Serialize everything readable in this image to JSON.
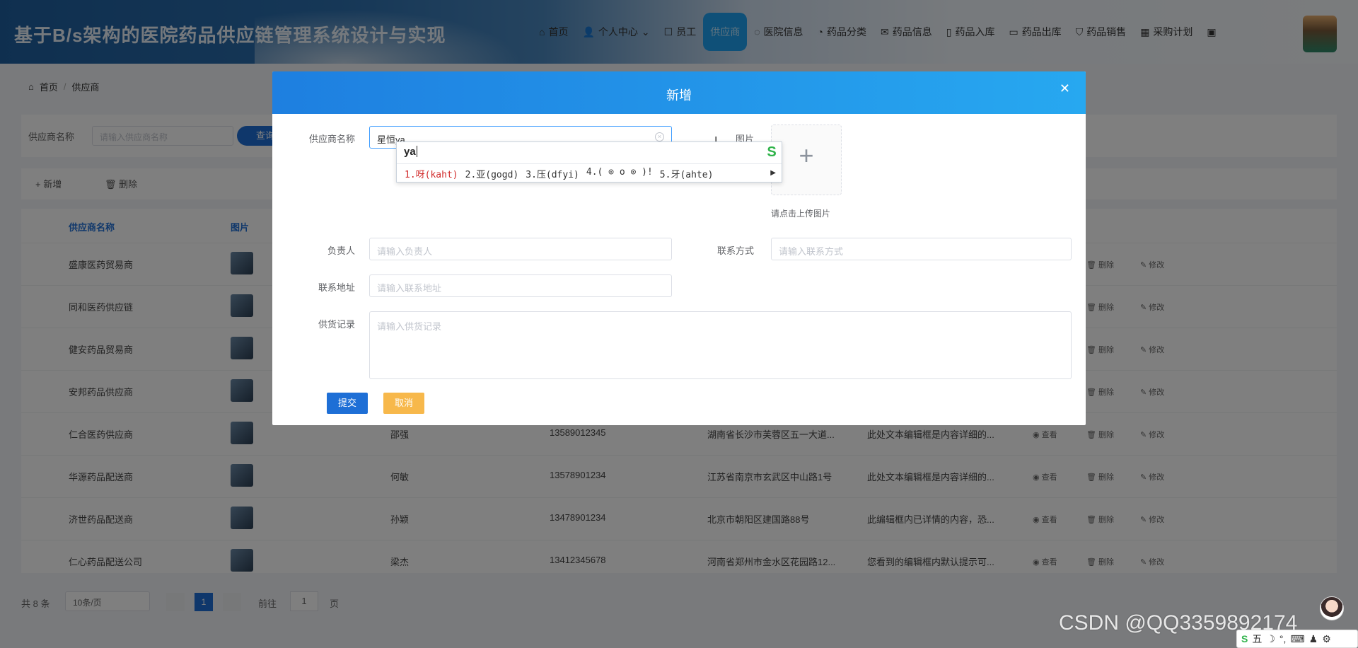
{
  "header": {
    "system_title": "基于B/s架构的医院药品供应链管理系统设计与实现",
    "nav": [
      {
        "icon": "home-icon",
        "glyph": "⌂",
        "label": "首页",
        "active": false
      },
      {
        "icon": "user-icon",
        "glyph": "👤",
        "label": "个人中心",
        "active": false,
        "dropdown": "⌄"
      },
      {
        "icon": "staff-icon",
        "glyph": "☐",
        "label": "员工",
        "active": false
      },
      {
        "icon": "supplier-icon",
        "glyph": "",
        "label": "供应商",
        "active": true
      },
      {
        "icon": "chat-icon",
        "glyph": "◌",
        "label": "医院信息",
        "active": false
      },
      {
        "icon": "clock-icon",
        "glyph": "◔",
        "label": "药品分类",
        "active": false
      },
      {
        "icon": "mail-icon",
        "glyph": "✉",
        "label": "药品信息",
        "active": false
      },
      {
        "icon": "door-icon",
        "glyph": "▯",
        "label": "药品入库",
        "active": false
      },
      {
        "icon": "card-icon",
        "glyph": "▭",
        "label": "药品出库",
        "active": false
      },
      {
        "icon": "cart-icon",
        "glyph": "⛉",
        "label": "药品销售",
        "active": false
      },
      {
        "icon": "building-icon",
        "glyph": "▦",
        "label": "采购计划",
        "active": false
      },
      {
        "icon": "grid-icon",
        "glyph": "▣",
        "label": "",
        "active": false
      }
    ]
  },
  "breadcrumb": {
    "home": "首页",
    "sep": "/",
    "current": "供应商"
  },
  "search": {
    "label": "供应商名称",
    "placeholder": "请输入供应商名称",
    "button": "查询"
  },
  "toolbar": {
    "add": "+ 新增",
    "delete": "🗑 删除"
  },
  "table": {
    "headers": {
      "name": "供应商名称",
      "image": "图片"
    },
    "rows": [
      {
        "name": "盛康医药贸易商",
        "contact": "",
        "phone": "",
        "address": "",
        "record": ""
      },
      {
        "name": "同和医药供应链",
        "contact": "",
        "phone": "",
        "address": "",
        "record": ""
      },
      {
        "name": "健安药品贸易商",
        "contact": "",
        "phone": "",
        "address": "",
        "record": ""
      },
      {
        "name": "安邦药品供应商",
        "contact": "",
        "phone": "",
        "address": "",
        "record": ""
      },
      {
        "name": "仁合医药供应商",
        "contact": "邵强",
        "phone": "13589012345",
        "address": "湖南省长沙市芙蓉区五一大道...",
        "record": "此处文本编辑框是内容详细的..."
      },
      {
        "name": "华源药品配送商",
        "contact": "何敏",
        "phone": "13578901234",
        "address": "江苏省南京市玄武区中山路1号",
        "record": "此处文本编辑框是内容详细的..."
      },
      {
        "name": "济世药品配送商",
        "contact": "孙颖",
        "phone": "13478901234",
        "address": "北京市朝阳区建国路88号",
        "record": "此编辑框内已详情的内容，恐..."
      },
      {
        "name": "仁心药品配送公司",
        "contact": "梁杰",
        "phone": "13412345678",
        "address": "河南省郑州市金水区花园路12...",
        "record": "您看到的编辑框内默认提示可..."
      }
    ],
    "actions": {
      "view": "◉ 查看",
      "delete": "🗑 删除",
      "edit": "✎ 修改"
    }
  },
  "pager": {
    "total": "共 8 条",
    "size": "10条/页",
    "current": "1",
    "goto": "前往",
    "goto_value": "1",
    "unit": "页"
  },
  "dialog": {
    "title": "新增",
    "close": "✕",
    "fields": {
      "supplier_label": "供应商名称",
      "supplier_value": "星恒ya",
      "image_label": "图片",
      "upload_plus": "+",
      "upload_tip": "请点击上传图片",
      "owner_label": "负责人",
      "owner_placeholder": "请输入负责人",
      "phone_label": "联系方式",
      "phone_placeholder": "请输入联系方式",
      "address_label": "联系地址",
      "address_placeholder": "请输入联系地址",
      "record_label": "供货记录",
      "record_placeholder": "请输入供货记录"
    },
    "submit": "提交",
    "cancel": "取消"
  },
  "ime": {
    "composition": "ya",
    "candidates": [
      "1.呀(kaht)",
      "2.亚(gogd)",
      "3.压(dfyi)",
      "4.( ⊙ o ⊙ )!",
      "5.牙(ahte)"
    ],
    "logo": "S"
  },
  "watermark": "CSDN @QQ3359892174",
  "ime_status": {
    "logo": "S",
    "items": [
      "五",
      "☽",
      "°,",
      "⌨",
      "♟",
      "⚙"
    ]
  }
}
